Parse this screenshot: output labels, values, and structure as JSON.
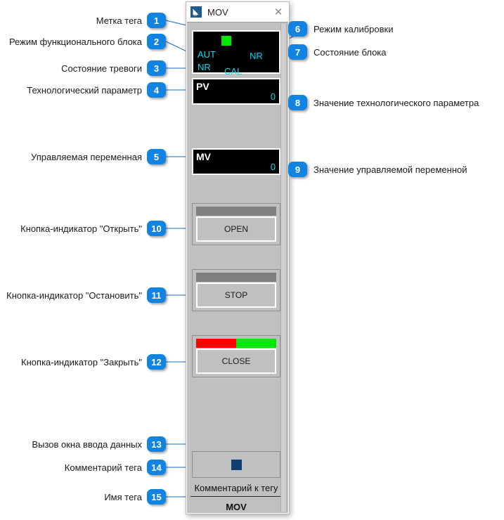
{
  "window": {
    "title": "MOV",
    "icon": "app-icon",
    "close_label": "✕"
  },
  "faceplate": {
    "status": {
      "tag_marker_color": "#00e800",
      "function_block_mode": "AUT",
      "alarm_state": "NR",
      "calibration_mode": "CAL",
      "block_state": "NR"
    },
    "process_value": {
      "label": "PV",
      "value": "0"
    },
    "manipulated_value": {
      "label": "MV",
      "value": "0"
    },
    "buttons": [
      {
        "name": "open",
        "label": "OPEN",
        "bar": [
          {
            "color": "#808080",
            "width": 100
          }
        ]
      },
      {
        "name": "stop",
        "label": "STOP",
        "bar": [
          {
            "color": "#808080",
            "width": 100
          }
        ]
      },
      {
        "name": "close",
        "label": "CLOSE",
        "bar": [
          {
            "color": "#ff0000",
            "width": 50
          },
          {
            "color": "#00e800",
            "width": 50
          }
        ]
      }
    ],
    "data_entry": {
      "square_color": "#0d3f73"
    },
    "tag_comment": "Комментарий к тегу",
    "tag_name": "MOV"
  },
  "accent_color": "#1183e0",
  "leader_color": "#1a6fc4",
  "annotations": [
    {
      "number": "1",
      "side": "left",
      "label": "Метка тега"
    },
    {
      "number": "2",
      "side": "left",
      "label": "Режим функционального блока"
    },
    {
      "number": "3",
      "side": "left",
      "label": "Состояние тревоги"
    },
    {
      "number": "4",
      "side": "left",
      "label": "Технологический параметр"
    },
    {
      "number": "5",
      "side": "left",
      "label": "Управляемая переменная"
    },
    {
      "number": "6",
      "side": "right",
      "label": "Режим калибровки"
    },
    {
      "number": "7",
      "side": "right",
      "label": "Состояние блока"
    },
    {
      "number": "8",
      "side": "right",
      "label": "Значение технологического параметра"
    },
    {
      "number": "9",
      "side": "right",
      "label": "Значение управляемой переменной"
    },
    {
      "number": "10",
      "side": "left",
      "label": "Кнопка-индикатор \"Открыть\""
    },
    {
      "number": "11",
      "side": "left",
      "label": "Кнопка-индикатор \"Остановить\""
    },
    {
      "number": "12",
      "side": "left",
      "label": "Кнопка-индикатор \"Закрыть\""
    },
    {
      "number": "13",
      "side": "left",
      "label": "Вызов окна ввода данных"
    },
    {
      "number": "14",
      "side": "left",
      "label": "Комментарий тега"
    },
    {
      "number": "15",
      "side": "left",
      "label": "Имя тега"
    }
  ]
}
